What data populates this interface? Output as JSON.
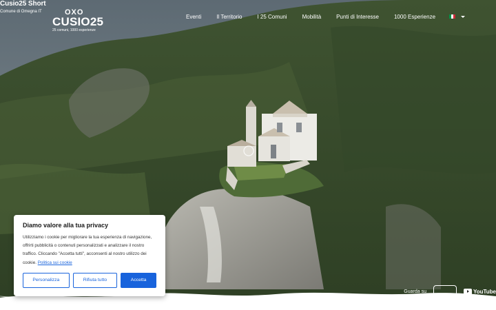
{
  "video": {
    "title": "Cusio25 Short",
    "channel": "Comune di Omegna IT"
  },
  "logo": {
    "mark": "OXO",
    "name": "CUSIO25",
    "tagline": "25 comuni, 1000 esperienze"
  },
  "nav": {
    "items": [
      {
        "label": "Eventi"
      },
      {
        "label": "Il Territorio"
      },
      {
        "label": "I 25 Comuni"
      },
      {
        "label": "Mobilità"
      },
      {
        "label": "Punti di Interesse"
      },
      {
        "label": "1000 Esperienze"
      }
    ],
    "language_flag_colors": [
      "#009246",
      "#ffffff",
      "#ce2b37"
    ]
  },
  "cookie_banner": {
    "title": "Diamo valore alla tua privacy",
    "body": "Utilizziamo i cookie per migliorare la tua esperienza di navigazione, offrirti pubblicità o contenuti personalizzati e analizzare il nostro traffico. Cliccando \"Accetta tutti\", acconsenti al nostro utilizzo dei cookie.",
    "link_text": "Politica sui cookie",
    "buttons": {
      "customize": "Personalizza",
      "reject": "Rifiuta tutto",
      "accept": "Accetta"
    },
    "accent_color": "#1863dc"
  },
  "youtube": {
    "watch_on": "Guarda su",
    "brand": "YouTube"
  }
}
